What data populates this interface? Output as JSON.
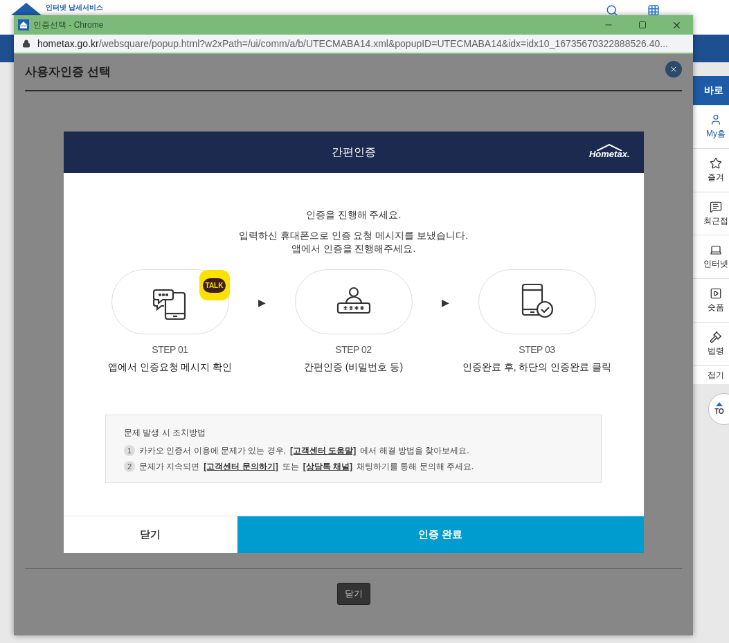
{
  "site_header": {
    "logo_caption": "인터넷 납세서비스"
  },
  "quick_menu": {
    "title": "바로",
    "items": [
      {
        "kind": "user",
        "label": "My홈",
        "selected": true
      },
      {
        "kind": "star",
        "label": "즐겨",
        "selected": false
      },
      {
        "kind": "recent",
        "label": "최근접",
        "selected": false
      },
      {
        "kind": "laptop",
        "label": "인터넷",
        "selected": false
      },
      {
        "kind": "play",
        "label": "숏폼",
        "selected": false
      },
      {
        "kind": "gavel",
        "label": "법령",
        "selected": false
      }
    ],
    "collapse": "접기",
    "top": "TO"
  },
  "window": {
    "title": "인증선택 - Chrome",
    "url_domain": "hometax.go.kr",
    "url_path": "/websquare/popup.html?w2xPath=/ui/comm/a/b/UTECMABA14.xml&popupID=UTECMABA14&idx=idx10_16735670322888526.40..."
  },
  "popup": {
    "title": "사용자인증 선택",
    "close_button": "닫기"
  },
  "modal": {
    "title": "간편인증",
    "logo_text": "Hometax.",
    "heading": "인증을 진행해 주세요.",
    "message_lines": [
      "입력하신 휴대폰으로 인증 요청 메시지를 보냈습니다.",
      "앱에서 인증을 진행해주세요."
    ],
    "steps": [
      {
        "kind": "chat-phone",
        "badge": "TALK",
        "step": "STEP 01",
        "caption": "앱에서 인증요청 메시지 확인"
      },
      {
        "kind": "user-password",
        "step": "STEP 02",
        "caption": "간편인증 (비밀번호 등)"
      },
      {
        "kind": "phone-check",
        "step": "STEP 03",
        "caption": "인증완료 후, 하단의 인증완료 클릭"
      }
    ],
    "step_arrow": "▶",
    "help": {
      "title": "문제 발생 시 조치방법",
      "items": [
        {
          "number": "1",
          "parts": [
            {
              "text": "카카오 인증서 이용에 문제가 있는 경우,",
              "link": false
            },
            {
              "text": "[고객센터 도움말]",
              "link": true
            },
            {
              "text": "에서 해결 방법을 찾아보세요.",
              "link": false
            }
          ]
        },
        {
          "number": "2",
          "parts": [
            {
              "text": "문제가 지속되면",
              "link": false
            },
            {
              "text": "[고객센터 문의하기]",
              "link": true
            },
            {
              "text": "또는",
              "link": false
            },
            {
              "text": "[상담톡 채널]",
              "link": true
            },
            {
              "text": "채팅하기를 통해 문의해 주세요.",
              "link": false
            }
          ]
        }
      ]
    },
    "buttons": [
      {
        "kind": "secondary",
        "label": "닫기"
      },
      {
        "kind": "primary",
        "label": "인증 완료"
      }
    ]
  }
}
